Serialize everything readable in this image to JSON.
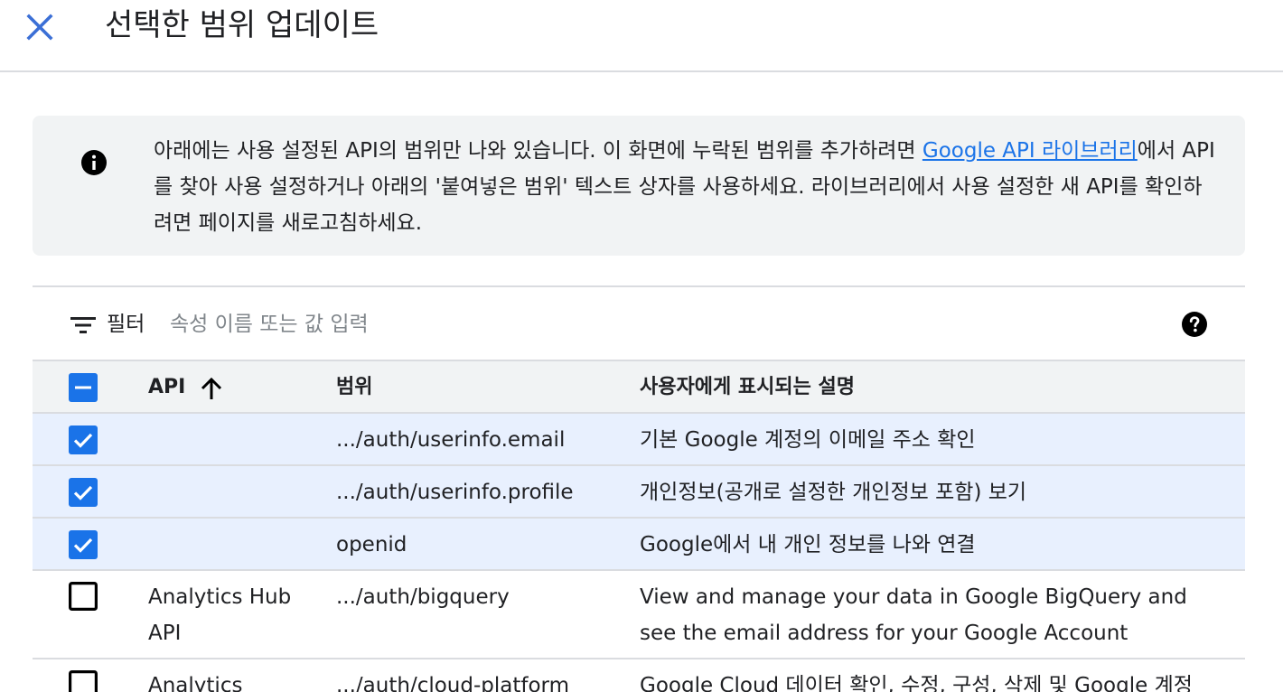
{
  "header": {
    "title": "선택한 범위 업데이트"
  },
  "info": {
    "text_before_link": "아래에는 사용 설정된 API의 범위만 나와 있습니다. 이 화면에 누락된 범위를 추가하려면 ",
    "link": "Google API 라이브러리",
    "text_after_link": "에서 API를 찾아 사용 설정하거나 아래의 '붙여넣은 범위' 텍스트 상자를 사용하세요. 라이브러리에서 사용 설정한 새 API를 확인하려면 페이지를 새로고침하세요."
  },
  "filter": {
    "label": "필터",
    "placeholder": "속성 이름 또는 값 입력"
  },
  "table": {
    "columns": {
      "api": "API",
      "scope": "범위",
      "description": "사용자에게 표시되는 설명"
    },
    "rows": [
      {
        "api": "",
        "scope": ".../auth/userinfo.email",
        "description": "기본 Google 계정의 이메일 주소 확인",
        "checked": true
      },
      {
        "api": "",
        "scope": ".../auth/userinfo.profile",
        "description": "개인정보(공개로 설정한 개인정보 포함) 보기",
        "checked": true
      },
      {
        "api": "",
        "scope": "openid",
        "description": "Google에서 내 개인 정보를 나와 연결",
        "checked": true
      },
      {
        "api": "Analytics Hub API",
        "scope": ".../auth/bigquery",
        "description": "View and manage your data in Google BigQuery and see the email address for your Google Account",
        "checked": false
      },
      {
        "api": "Analytics",
        "scope": ".../auth/cloud-platform",
        "description": "Google Cloud 데이터 확인, 수정, 구성, 삭제 및 Google 계정",
        "checked": false
      }
    ]
  },
  "colors": {
    "accent": "#1a73e8",
    "selected_row": "#e8f0fe",
    "header_bg": "#f1f3f4"
  },
  "icons": {
    "close": "close-icon",
    "info": "info-icon",
    "filter": "filter-icon",
    "help": "help-icon",
    "sort": "arrow-up-icon"
  }
}
